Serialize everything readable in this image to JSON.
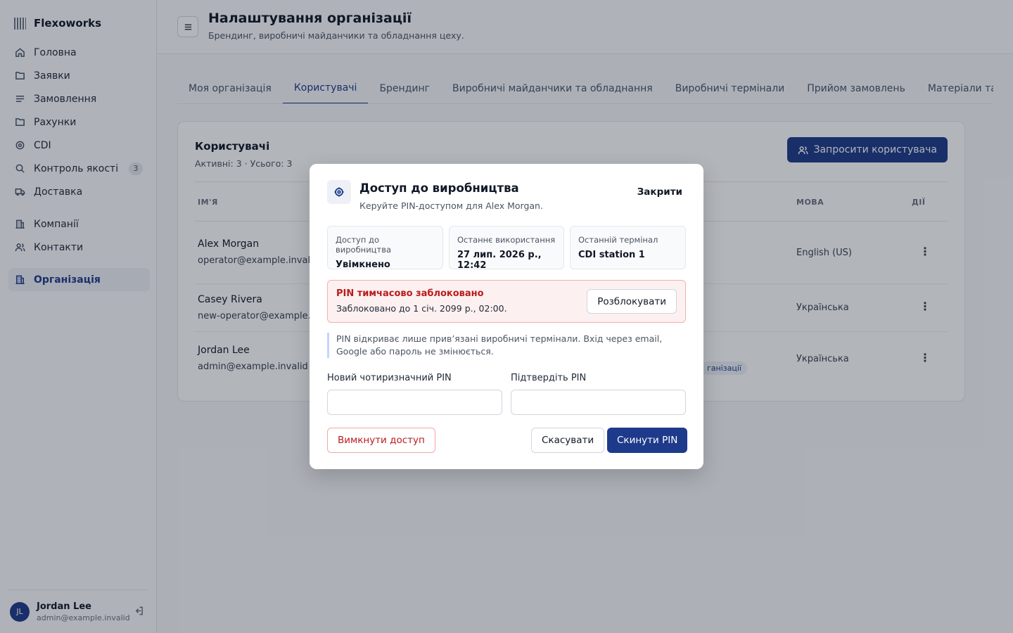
{
  "app": {
    "name": "Flexoworks"
  },
  "sidebar": {
    "items": [
      {
        "label": "Головна",
        "icon": "home-icon"
      },
      {
        "label": "Заявки",
        "icon": "folder-icon"
      },
      {
        "label": "Замовлення",
        "icon": "list-icon"
      },
      {
        "label": "Рахунки",
        "icon": "folder-icon"
      },
      {
        "label": "CDI",
        "icon": "target-icon"
      },
      {
        "label": "Контроль якості",
        "icon": "search-icon",
        "badge": "3"
      },
      {
        "label": "Доставка",
        "icon": "truck-icon"
      },
      {
        "label": "Компанії",
        "icon": "building-icon"
      },
      {
        "label": "Контакти",
        "icon": "users-icon"
      },
      {
        "label": "Організація",
        "icon": "building-icon",
        "active": true
      }
    ],
    "user": {
      "initials": "JL",
      "name": "Jordan Lee",
      "email": "admin@example.invalid"
    }
  },
  "header": {
    "title": "Налаштування організації",
    "subtitle": "Брендинг, виробничі майданчики та обладнання цеху."
  },
  "tabs": [
    {
      "label": "Моя організація"
    },
    {
      "label": "Користувачі",
      "active": true
    },
    {
      "label": "Брендинг"
    },
    {
      "label": "Виробничі майданчики та обладнання"
    },
    {
      "label": "Виробничі термінали"
    },
    {
      "label": "Прийом замовлень"
    },
    {
      "label": "Матеріали та по"
    }
  ],
  "users_card": {
    "title": "Користувачі",
    "subtitle": "Активні: 3 · Усього: 3",
    "invite_label": "Запросити користувача",
    "columns": {
      "name": "ІМ'Я",
      "language": "МОВА",
      "actions": "ДІЇ"
    },
    "rows": [
      {
        "name": "Alex Morgan",
        "email": "operator@example.invalid",
        "language": "English (US)"
      },
      {
        "name": "Casey Rivera",
        "email": "new-operator@example.invalid",
        "language": "Українська"
      },
      {
        "name": "Jordan Lee",
        "email": "admin@example.invalid",
        "language": "Українська",
        "role_fragment": "ганізації"
      }
    ]
  },
  "modal": {
    "title": "Доступ до виробництва",
    "subtitle": "Керуйте PIN-доступом для Alex Morgan.",
    "close_label": "Закрити",
    "stats": [
      {
        "label": "Доступ до виробництва",
        "value": "Увімкнено"
      },
      {
        "label": "Останнє використання",
        "value": "27 лип. 2026 р., 12:42"
      },
      {
        "label": "Останній термінал",
        "value": "CDI station 1"
      }
    ],
    "lock": {
      "title": "PIN тимчасово заблоковано",
      "detail": "Заблоковано до 1 січ. 2099 р., 02:00.",
      "unlock_label": "Розблокувати"
    },
    "note": "PIN відкриває лише прив’язані виробничі термінали. Вхід через email, Google або пароль не змінюється.",
    "new_pin_label": "Новий чотиризначний PIN",
    "new_pin_value": "",
    "confirm_pin_label": "Підтвердіть PIN",
    "confirm_pin_value": "",
    "disable_label": "Вимкнути доступ",
    "cancel_label": "Скасувати",
    "reset_label": "Скинути PIN"
  },
  "colors": {
    "accent": "#1e3a8a",
    "danger": "#b91c1c",
    "danger_bg": "#fdf0f0"
  }
}
